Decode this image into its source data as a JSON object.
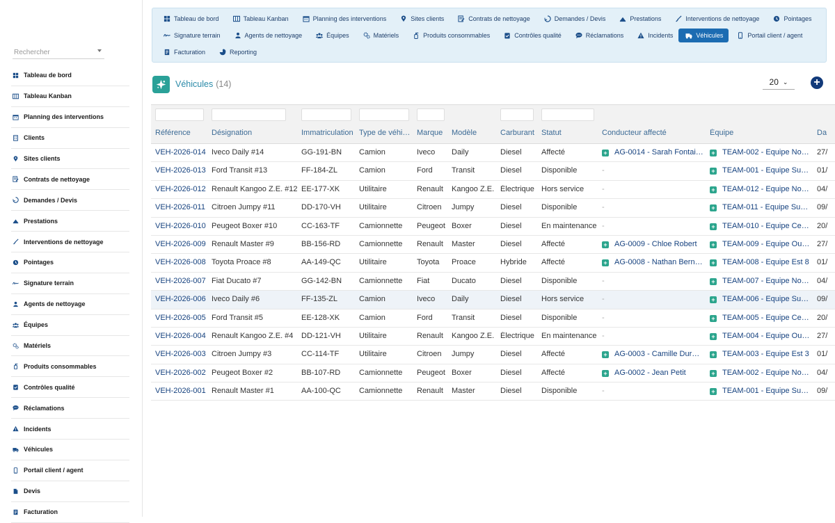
{
  "sidebar": {
    "search_placeholder": "Rechercher",
    "items": [
      {
        "label": "Tableau de bord",
        "icon": "dashboard-icon"
      },
      {
        "label": "Tableau Kanban",
        "icon": "kanban-icon"
      },
      {
        "label": "Planning des interventions",
        "icon": "calendar-icon"
      },
      {
        "label": "Clients",
        "icon": "building-icon"
      },
      {
        "label": "Sites clients",
        "icon": "map-pin-icon"
      },
      {
        "label": "Contrats de nettoyage",
        "icon": "contract-icon"
      },
      {
        "label": "Demandes / Devis",
        "icon": "request-icon"
      },
      {
        "label": "Prestations",
        "icon": "service-icon"
      },
      {
        "label": "Interventions de nettoyage",
        "icon": "broom-icon"
      },
      {
        "label": "Pointages",
        "icon": "clock-icon"
      },
      {
        "label": "Signature terrain",
        "icon": "signature-icon"
      },
      {
        "label": "Agents de nettoyage",
        "icon": "user-icon"
      },
      {
        "label": "Équipes",
        "icon": "team-icon"
      },
      {
        "label": "Matériels",
        "icon": "gears-icon"
      },
      {
        "label": "Produits consommables",
        "icon": "bottle-icon"
      },
      {
        "label": "Contrôles qualité",
        "icon": "clipboard-check-icon"
      },
      {
        "label": "Réclamations",
        "icon": "chat-icon"
      },
      {
        "label": "Incidents",
        "icon": "warning-icon"
      },
      {
        "label": "Véhicules",
        "icon": "truck-icon"
      },
      {
        "label": "Portail client / agent",
        "icon": "mobile-icon"
      },
      {
        "label": "Devis",
        "icon": "file-icon"
      },
      {
        "label": "Facturation",
        "icon": "invoice-icon"
      }
    ]
  },
  "topnav": {
    "row1": [
      {
        "label": "Tableau de bord",
        "icon": "dashboard-icon"
      },
      {
        "label": "Tableau Kanban",
        "icon": "kanban-icon"
      },
      {
        "label": "Planning des interventions",
        "icon": "calendar-icon"
      },
      {
        "label": "Sites clients",
        "icon": "map-pin-icon"
      },
      {
        "label": "Contrats de nettoyage",
        "icon": "contract-icon"
      },
      {
        "label": "Demandes / Devis",
        "icon": "request-icon"
      },
      {
        "label": "Prestations",
        "icon": "service-icon"
      },
      {
        "label": "Interventions de nettoyage",
        "icon": "broom-icon"
      },
      {
        "label": "Pointages",
        "icon": "clock-icon"
      }
    ],
    "row2": [
      {
        "label": "Signature terrain",
        "icon": "signature-icon"
      },
      {
        "label": "Agents de nettoyage",
        "icon": "user-icon"
      },
      {
        "label": "Équipes",
        "icon": "team-icon"
      },
      {
        "label": "Matériels",
        "icon": "gears-icon"
      },
      {
        "label": "Produits consommables",
        "icon": "bottle-icon"
      },
      {
        "label": "Contrôles qualité",
        "icon": "clipboard-check-icon"
      },
      {
        "label": "Réclamations",
        "icon": "chat-icon"
      },
      {
        "label": "Incidents",
        "icon": "warning-icon"
      },
      {
        "label": "Véhicules",
        "icon": "truck-icon",
        "active": true
      },
      {
        "label": "Portail client / agent",
        "icon": "mobile-icon"
      }
    ],
    "row3": [
      {
        "label": "Facturation",
        "icon": "invoice-icon"
      },
      {
        "label": "Reporting",
        "icon": "chart-icon"
      }
    ]
  },
  "page": {
    "title": "Véhicules",
    "count": "(14)",
    "per_page": "20",
    "add_icon": "plus-circle-icon"
  },
  "table": {
    "columns": [
      "Référence",
      "Désignation",
      "Immatriculation",
      "Type de véhi…",
      "Marque",
      "Modèle",
      "Carburant",
      "Statut",
      "Conducteur affecté",
      "Équipe",
      "Da"
    ],
    "rows": [
      {
        "ref": "VEH-2026-014",
        "des": "Iveco Daily #14",
        "imm": "GG-191-BN",
        "type": "Camion",
        "marque": "Iveco",
        "modele": "Daily",
        "carb": "Diesel",
        "statut": "Affecté",
        "cond": "AG-0014 - Sarah Fontai…",
        "equipe": "TEAM-002 - Equipe No…",
        "date": "27/"
      },
      {
        "ref": "VEH-2026-013",
        "des": "Ford Transit #13",
        "imm": "FF-184-ZL",
        "type": "Camion",
        "marque": "Ford",
        "modele": "Transit",
        "carb": "Diesel",
        "statut": "Disponible",
        "cond": "-",
        "equipe": "TEAM-001 - Equipe Su…",
        "date": "01/"
      },
      {
        "ref": "VEH-2026-012",
        "des": "Renault Kangoo Z.E. #12",
        "imm": "EE-177-XK",
        "type": "Utilitaire",
        "marque": "Renault",
        "modele": "Kangoo Z.E.",
        "carb": "Électrique",
        "statut": "Hors service",
        "cond": "-",
        "equipe": "TEAM-012 - Equipe No…",
        "date": "04/"
      },
      {
        "ref": "VEH-2026-011",
        "des": "Citroen Jumpy #11",
        "imm": "DD-170-VH",
        "type": "Utilitaire",
        "marque": "Citroen",
        "modele": "Jumpy",
        "carb": "Diesel",
        "statut": "Disponible",
        "cond": "-",
        "equipe": "TEAM-011 - Equipe Su…",
        "date": "09/"
      },
      {
        "ref": "VEH-2026-010",
        "des": "Peugeot Boxer #10",
        "imm": "CC-163-TF",
        "type": "Camionnette",
        "marque": "Peugeot",
        "modele": "Boxer",
        "carb": "Diesel",
        "statut": "En maintenance",
        "cond": "-",
        "equipe": "TEAM-010 - Equipe Ce…",
        "date": "20/"
      },
      {
        "ref": "VEH-2026-009",
        "des": "Renault Master #9",
        "imm": "BB-156-RD",
        "type": "Camionnette",
        "marque": "Renault",
        "modele": "Master",
        "carb": "Diesel",
        "statut": "Affecté",
        "cond": "AG-0009 - Chloe Robert",
        "equipe": "TEAM-009 - Equipe Ou…",
        "date": "27/"
      },
      {
        "ref": "VEH-2026-008",
        "des": "Toyota Proace #8",
        "imm": "AA-149-QC",
        "type": "Utilitaire",
        "marque": "Toyota",
        "modele": "Proace",
        "carb": "Hybride",
        "statut": "Affecté",
        "cond": "AG-0008 - Nathan Bern…",
        "equipe": "TEAM-008 - Equipe Est 8",
        "date": "01/"
      },
      {
        "ref": "VEH-2026-007",
        "des": "Fiat Ducato #7",
        "imm": "GG-142-BN",
        "type": "Camionnette",
        "marque": "Fiat",
        "modele": "Ducato",
        "carb": "Diesel",
        "statut": "Disponible",
        "cond": "-",
        "equipe": "TEAM-007 - Equipe No…",
        "date": "04/"
      },
      {
        "ref": "VEH-2026-006",
        "des": "Iveco Daily #6",
        "imm": "FF-135-ZL",
        "type": "Camion",
        "marque": "Iveco",
        "modele": "Daily",
        "carb": "Diesel",
        "statut": "Hors service",
        "cond": "-",
        "equipe": "TEAM-006 - Equipe Su…",
        "date": "09/",
        "highlight": true
      },
      {
        "ref": "VEH-2026-005",
        "des": "Ford Transit #5",
        "imm": "EE-128-XK",
        "type": "Camion",
        "marque": "Ford",
        "modele": "Transit",
        "carb": "Diesel",
        "statut": "Disponible",
        "cond": "-",
        "equipe": "TEAM-005 - Equipe Ce…",
        "date": "20/"
      },
      {
        "ref": "VEH-2026-004",
        "des": "Renault Kangoo Z.E. #4",
        "imm": "DD-121-VH",
        "type": "Utilitaire",
        "marque": "Renault",
        "modele": "Kangoo Z.E.",
        "carb": "Électrique",
        "statut": "En maintenance",
        "cond": "-",
        "equipe": "TEAM-004 - Equipe Ou…",
        "date": "27/"
      },
      {
        "ref": "VEH-2026-003",
        "des": "Citroen Jumpy #3",
        "imm": "CC-114-TF",
        "type": "Utilitaire",
        "marque": "Citroen",
        "modele": "Jumpy",
        "carb": "Diesel",
        "statut": "Affecté",
        "cond": "AG-0003 - Camille Dur…",
        "equipe": "TEAM-003 - Equipe Est 3",
        "date": "01/"
      },
      {
        "ref": "VEH-2026-002",
        "des": "Peugeot Boxer #2",
        "imm": "BB-107-RD",
        "type": "Camionnette",
        "marque": "Peugeot",
        "modele": "Boxer",
        "carb": "Diesel",
        "statut": "Affecté",
        "cond": "AG-0002 - Jean Petit",
        "equipe": "TEAM-002 - Equipe No…",
        "date": "04/"
      },
      {
        "ref": "VEH-2026-001",
        "des": "Renault Master #1",
        "imm": "AA-100-QC",
        "type": "Camionnette",
        "marque": "Renault",
        "modele": "Master",
        "carb": "Diesel",
        "statut": "Disponible",
        "cond": "-",
        "equipe": "TEAM-001 - Equipe Su…",
        "date": "09/"
      }
    ]
  },
  "colors": {
    "accent": "#1c6cb2",
    "nav_bg": "#e3f0f8",
    "link": "#16427f",
    "header_text": "#3b6a95",
    "badge_green": "#2ca58d"
  }
}
